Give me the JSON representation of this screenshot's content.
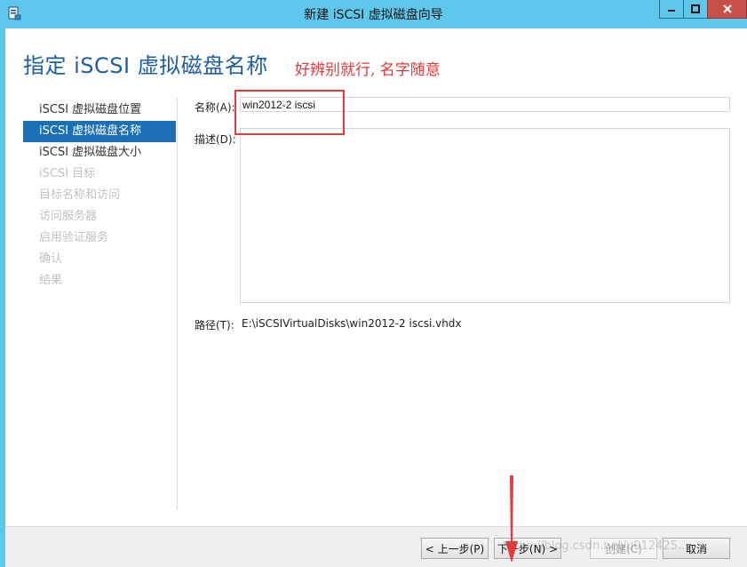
{
  "window": {
    "title": "新建 iSCSI 虚拟磁盘向导",
    "titlebar_color": "#5dc8ec"
  },
  "heading": "指定 iSCSI 虚拟磁盘名称",
  "annotation": "好辨别就行, 名字随意",
  "nav": {
    "items": [
      {
        "label": "iSCSI 虚拟磁盘位置",
        "state": "normal"
      },
      {
        "label": "iSCSI 虚拟磁盘名称",
        "state": "active"
      },
      {
        "label": "iSCSI 虚拟磁盘大小",
        "state": "normal"
      },
      {
        "label": "iSCSI 目标",
        "state": "disabled"
      },
      {
        "label": "目标名称和访问",
        "state": "disabled"
      },
      {
        "label": "访问服务器",
        "state": "disabled"
      },
      {
        "label": "启用验证服务",
        "state": "disabled"
      },
      {
        "label": "确认",
        "state": "disabled"
      },
      {
        "label": "结果",
        "state": "disabled"
      }
    ]
  },
  "form": {
    "name_label": "名称(A):",
    "name_value": "win2012-2 iscsi",
    "desc_label": "描述(D):",
    "desc_value": "",
    "path_label": "路径(T):",
    "path_value": "E:\\iSCSIVirtualDisks\\win2012-2 iscsi.vhdx"
  },
  "buttons": {
    "prev": "< 上一步(P)",
    "next": "下一步(N) >",
    "create": "创建(C)",
    "cancel": "取消"
  },
  "watermark": "https://blog.csdn.net/u012425..."
}
